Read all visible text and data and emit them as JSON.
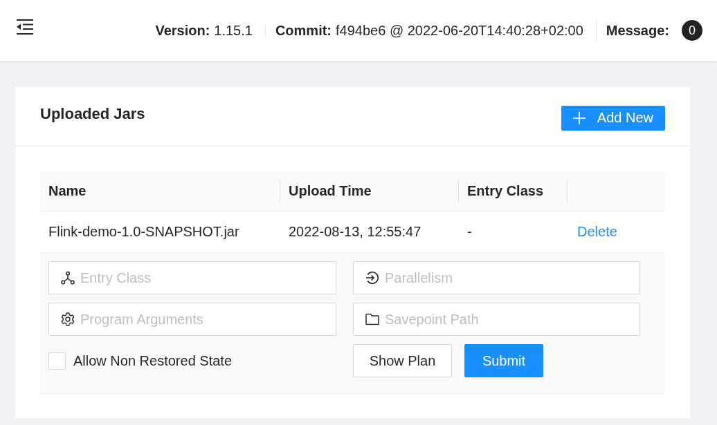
{
  "header": {
    "version": {
      "label": "Version:",
      "value": "1.15.1"
    },
    "commit": {
      "label": "Commit:",
      "value": "f494be6 @ 2022-06-20T14:40:28+02:00"
    },
    "message": {
      "label": "Message:",
      "count": "0"
    }
  },
  "panel": {
    "title": "Uploaded Jars",
    "add_button": "Add New",
    "table": {
      "columns": [
        "Name",
        "Upload Time",
        "Entry Class"
      ],
      "rows": [
        {
          "name": "Flink-demo-1.0-SNAPSHOT.jar",
          "upload_time": "2022-08-13, 12:55:47",
          "entry_class": "-",
          "action": "Delete",
          "expanded": true,
          "form": {
            "fields": [
              {
                "kind": "class",
                "placeholder": "Entry Class"
              },
              {
                "kind": "parallelism",
                "placeholder": "Parallelism"
              },
              {
                "kind": "arguments",
                "placeholder": "Program Arguments"
              },
              {
                "kind": "path",
                "placeholder": "Savepoint Path"
              }
            ],
            "checkbox": {
              "label": "Allow Non Restored State",
              "checked": false
            },
            "buttons": [
              {
                "kind": "default",
                "label": "Show Plan"
              },
              {
                "kind": "primary",
                "label": "Submit"
              }
            ]
          }
        }
      ]
    }
  }
}
